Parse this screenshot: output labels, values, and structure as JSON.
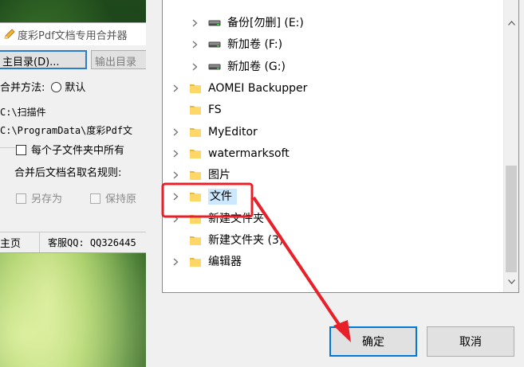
{
  "app": {
    "title": "度彩Pdf文档专用合并器",
    "buttons": {
      "main_dir": "主目录(D)...",
      "output_dir": "输出目录"
    },
    "merge_method_label": "合并方法:",
    "radio_default": "默认",
    "path1": "C:\\扫描件",
    "path2": "C:\\ProgramData\\度彩Pdf文",
    "subfolder_option": "每个子文件夹中所有",
    "naming_rule_label": "合并后文档名取名规则:",
    "save_as": "另存为",
    "keep_original": "保持原",
    "status": {
      "home": "主页",
      "support": "客服QQ: QQ326445"
    }
  },
  "dialog": {
    "tree": [
      {
        "label": "备份[勿删] (E:)",
        "type": "drive",
        "indent": 1,
        "expandable": true,
        "selected": false
      },
      {
        "label": "新加卷 (F:)",
        "type": "drive",
        "indent": 1,
        "expandable": true,
        "selected": false
      },
      {
        "label": "新加卷 (G:)",
        "type": "drive",
        "indent": 1,
        "expandable": true,
        "selected": false
      },
      {
        "label": "AOMEI Backupper",
        "type": "folder",
        "indent": 0,
        "expandable": true,
        "selected": false
      },
      {
        "label": "FS",
        "type": "folder",
        "indent": 0,
        "expandable": false,
        "selected": false
      },
      {
        "label": "MyEditor",
        "type": "folder",
        "indent": 0,
        "expandable": true,
        "selected": false
      },
      {
        "label": "watermarksoft",
        "type": "folder",
        "indent": 0,
        "expandable": true,
        "selected": false
      },
      {
        "label": "图片",
        "type": "folder",
        "indent": 0,
        "expandable": true,
        "selected": false
      },
      {
        "label": "文件",
        "type": "folder",
        "indent": 0,
        "expandable": true,
        "selected": true
      },
      {
        "label": "新建文件夹",
        "type": "folder",
        "indent": 0,
        "expandable": true,
        "selected": false
      },
      {
        "label": "新建文件夹 (3)",
        "type": "folder",
        "indent": 0,
        "expandable": false,
        "selected": false
      },
      {
        "label": "编辑器",
        "type": "folder",
        "indent": 0,
        "expandable": true,
        "selected": false
      }
    ],
    "ok_label": "确定",
    "cancel_label": "取消"
  },
  "colors": {
    "selection": "#cce8ff",
    "accent_border": "#0078d7",
    "annotation_red": "#e8202a",
    "folder_yellow": "#ffd766"
  }
}
